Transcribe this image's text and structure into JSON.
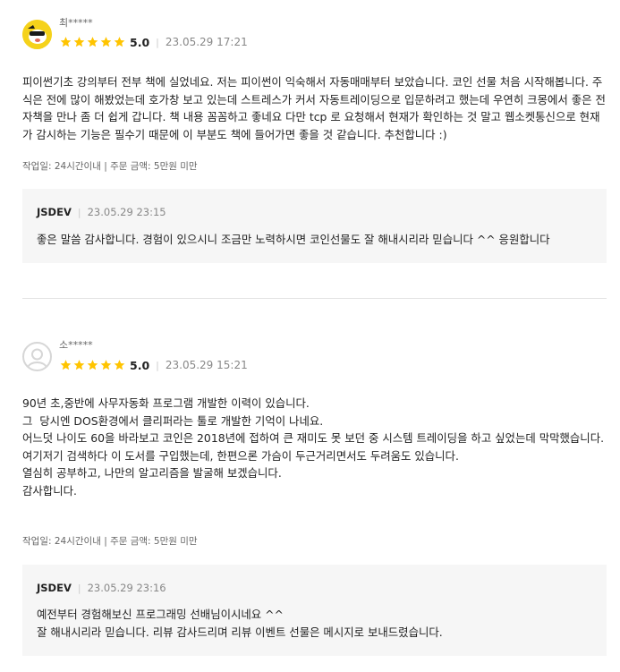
{
  "reviews": [
    {
      "username": "최*****",
      "avatar": "yellow-character-avatar",
      "stars": 5,
      "score": "5.0",
      "date": "23.05.29 17:21",
      "body": "피이썬기초 강의부터 전부 책에 실었네요. 저는 피이썬이 익숙해서 자동매매부터 보았습니다. 코인 선물 처음 시작해봅니다. 주식은 전에 많이 해봤었는데 호가창 보고 있는데 스트레스가 커서 자동트레이딩으로 입문하려고 했는데 우연히 크몽에서 좋은 전자책을 만나 좀 더 쉽게 갑니다. 책 내용 꼼꼼하고 좋네요 다만 tcp 로 요청해서 현재가 확인하는 것 말고 웹소켓통신으로 현재가 감시하는 기능은 필수기 때문에 이 부분도 책에 들어가면 좋을 것 같습니다. 추천합니다 :)",
      "meta": "작업일: 24시간이내 | 주문 금액: 5만원 미만",
      "reply": {
        "author": "JSDEV",
        "date": "23.05.29 23:15",
        "text": "좋은 말씀 감사합니다. 경험이 있으시니 조금만 노력하시면 코인선물도 잘 해내시리라 믿습니다 ^^ 응원합니다"
      }
    },
    {
      "username": "소*****",
      "avatar": "default-avatar",
      "stars": 5,
      "score": "5.0",
      "date": "23.05.29 15:21",
      "body": "90년 초,중반에 사무자동화 프로그램 개발한 이력이 있습니다.\n그  당시엔 DOS환경에서 클리퍼라는 툴로 개발한 기억이 나네요.\n어느덧 나이도 60을 바라보고 코인은 2018년에 접하여 큰 재미도 못 보던 중 시스템 트레이딩을 하고 싶었는데 막막했습니다.\n여기저기 검색하다 이 도서를 구입했는데, 한편으론 가슴이 두근거리면서도 두려움도 있습니다.\n열심히 공부하고, 나만의 알고리즘을 발굴해 보겠습니다.\n감사합니다.",
      "meta": "작업일: 24시간이내 | 주문 금액: 5만원 미만",
      "reply": {
        "author": "JSDEV",
        "date": "23.05.29 23:16",
        "text": "예전부터 경험해보신 프로그래밍 선배님이시네요 ^^\n잘 해내시리라 믿습니다. 리뷰 감사드리며 리뷰 이벤트 선물은 메시지로 보내드렸습니다."
      }
    }
  ],
  "colors": {
    "star": "#ffc400",
    "reply_bg": "#f6f6f6",
    "divider": "#e3e3e3"
  }
}
